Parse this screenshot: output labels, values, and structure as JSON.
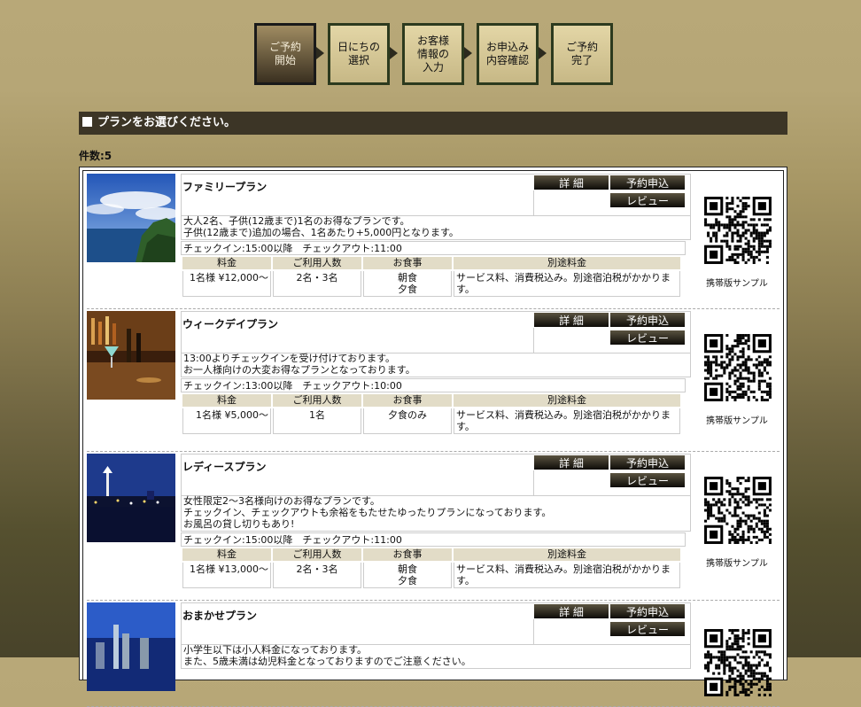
{
  "steps": [
    {
      "label": "ご予約\n開始",
      "active": true
    },
    {
      "label": "日にちの\n選択",
      "active": false
    },
    {
      "label": "お客様\n情報の\n入力",
      "active": false
    },
    {
      "label": "お申込み\n内容確認",
      "active": false
    },
    {
      "label": "ご予約\n完了",
      "active": false
    }
  ],
  "section_title": "プランをお選びください。",
  "count": "件数:5",
  "labels": {
    "detail": "詳 細",
    "reserve": "予約申込",
    "review": "レビュー",
    "mobile": "携帯版サンプル",
    "col_price": "料金",
    "col_people": "ご利用人数",
    "col_meal": "お食事",
    "col_extra": "別途料金"
  },
  "colors": {
    "header_bg": "#3c3526",
    "button_bg": "#0e0c08",
    "table_header_bg": "#e2dcc7",
    "step_border": "#2c3a1e"
  },
  "plans": [
    {
      "name": "ファミリープラン",
      "photo": "ocean-coast",
      "desc": [
        "大人2名、子供(12歳まで)1名のお得なプランです。",
        "子供(12歳まで)追加の場合、1名あたり+5,000円となります。"
      ],
      "checkin": "チェックイン:15:00以降　チェックアウト:11:00",
      "price": "1名様 ¥12,000〜",
      "people": "2名・3名",
      "meal": [
        "朝食",
        "夕食"
      ],
      "extra": "サービス料、消費税込み。別途宿泊税がかかります。"
    },
    {
      "name": "ウィークデイプラン",
      "photo": "bar-cocktail",
      "desc": [
        "13:00よりチェックインを受け付けております。",
        "お一人様向けの大変お得なプランとなっております。"
      ],
      "checkin": "チェックイン:13:00以降　チェックアウト:10:00",
      "price": "1名様 ¥5,000〜",
      "people": "1名",
      "meal": [
        "夕食のみ"
      ],
      "extra": "サービス料、消費税込み。別途宿泊税がかかります。"
    },
    {
      "name": "レディースプラン",
      "photo": "night-harbor",
      "desc": [
        "女性限定2〜3名様向けのお得なプランです。",
        "チェックイン、チェックアウトも余裕をもたせたゆったりプランになっております。",
        "お風呂の貸し切りもあり!"
      ],
      "checkin": "チェックイン:15:00以降　チェックアウト:11:00",
      "price": "1名様 ¥13,000〜",
      "people": "2名・3名",
      "meal": [
        "朝食",
        "夕食"
      ],
      "extra": "サービス料、消費税込み。別途宿泊税がかかります。"
    },
    {
      "name": "おまかせプラン",
      "photo": "night-city",
      "desc": [
        "小学生以下は小人料金になっております。",
        "また、5歳未満は幼児料金となっておりますのでご注意ください。"
      ]
    }
  ]
}
